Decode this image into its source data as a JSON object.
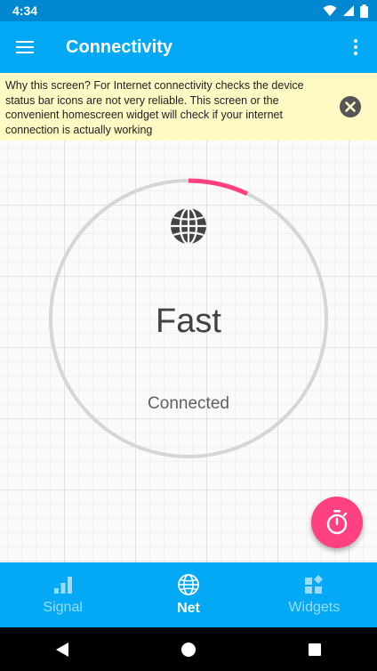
{
  "status_bar": {
    "time": "4:34"
  },
  "app_bar": {
    "title": "Connectivity"
  },
  "banner": {
    "text": "Why this screen? For Internet connectivity checks the device status bar icons are not very reliable. This screen or the convenient homescreen widget will check if your internet connection is actually working"
  },
  "main": {
    "speed_label": "Fast",
    "connection_status": "Connected",
    "gauge_progress_fraction": 0.07
  },
  "bottom_nav": [
    {
      "label": "Signal",
      "icon": "signal-bars-icon",
      "active": false
    },
    {
      "label": "Net",
      "icon": "globe-icon",
      "active": true
    },
    {
      "label": "Widgets",
      "icon": "widgets-icon",
      "active": false
    }
  ],
  "colors": {
    "primary": "#03a9f4",
    "primary_dark": "#0288d1",
    "accent": "#ff4081",
    "banner_bg": "#fff9c4"
  }
}
